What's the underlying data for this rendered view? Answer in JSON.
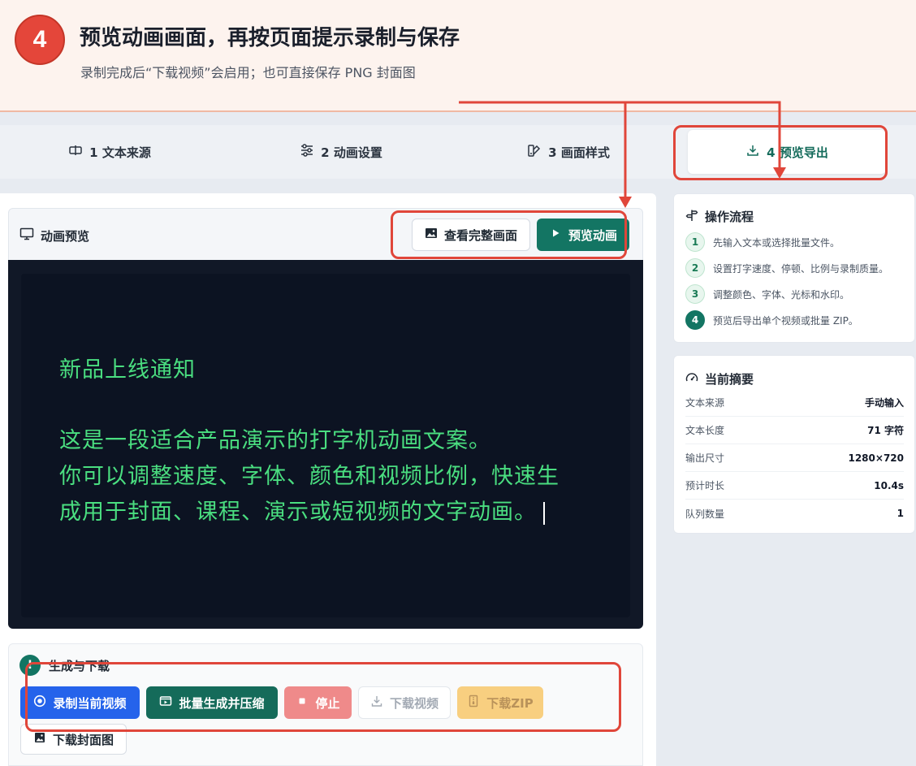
{
  "banner": {
    "step": "4",
    "title": "预览动画画面，再按页面提示录制与保存",
    "subtitle": "录制完成后“下载视频”会启用；也可直接保存 PNG 封面图"
  },
  "tabs": [
    {
      "label": "1 文本来源",
      "icon": "text-cursor-icon"
    },
    {
      "label": "2 动画设置",
      "icon": "sliders-icon"
    },
    {
      "label": "3 画面样式",
      "icon": "palette-icon"
    },
    {
      "label": "4 预览导出",
      "icon": "download-icon",
      "active": true
    }
  ],
  "preview": {
    "title": "动画预览",
    "view_full_label": "查看完整画面",
    "play_label": "预览动画",
    "lines": [
      "新品上线通知",
      "这是一段适合产品演示的打字机动画文案。",
      "你可以调整速度、字体、颜色和视频比例，快速生",
      "成用于封面、课程、演示或短视频的文字动画。"
    ]
  },
  "generate": {
    "title": "生成与下载",
    "record_label": "录制当前视频",
    "batch_label": "批量生成并压缩",
    "stop_label": "停止",
    "download_video_label": "下载视频",
    "download_zip_label": "下载ZIP",
    "download_cover_label": "下载封面图"
  },
  "workflow": {
    "title": "操作流程",
    "steps": [
      {
        "num": "1",
        "text": "先输入文本或选择批量文件。"
      },
      {
        "num": "2",
        "text": "设置打字速度、停顿、比例与录制质量。"
      },
      {
        "num": "3",
        "text": "调整颜色、字体、光标和水印。"
      },
      {
        "num": "4",
        "text": "预览后导出单个视频或批量 ZIP。"
      }
    ]
  },
  "summary": {
    "title": "当前摘要",
    "rows": [
      {
        "key": "文本来源",
        "value": "手动输入"
      },
      {
        "key": "文本长度",
        "value": "71 字符"
      },
      {
        "key": "输出尺寸",
        "value": "1280×720"
      },
      {
        "key": "预计时长",
        "value": "10.4s"
      },
      {
        "key": "队列数量",
        "value": "1"
      }
    ]
  },
  "colors": {
    "accent": "#137563",
    "annotation": "#e0463a",
    "stage_text": "#4ade80",
    "record_button": "#2563eb"
  }
}
